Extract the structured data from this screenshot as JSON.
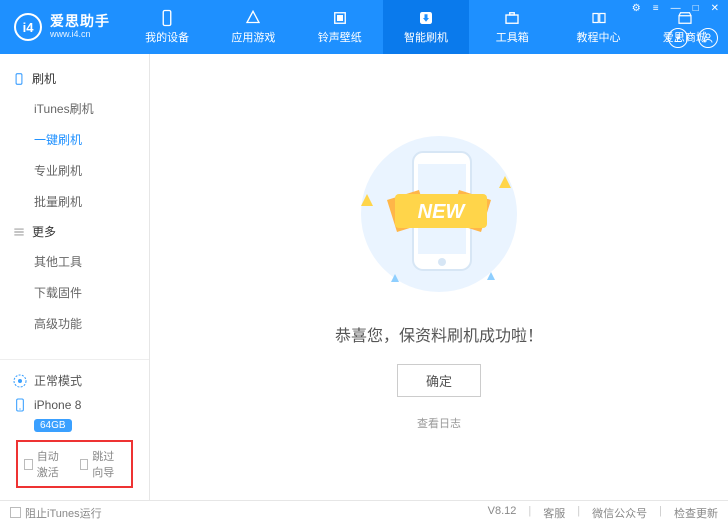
{
  "logo": {
    "badge": "i4",
    "title": "爱思助手",
    "url": "www.i4.cn"
  },
  "nav": [
    {
      "label": "我的设备",
      "icon": "device"
    },
    {
      "label": "应用游戏",
      "icon": "apps"
    },
    {
      "label": "铃声壁纸",
      "icon": "ringtone"
    },
    {
      "label": "智能刷机",
      "icon": "flash",
      "active": true
    },
    {
      "label": "工具箱",
      "icon": "toolbox"
    },
    {
      "label": "教程中心",
      "icon": "tutorial"
    },
    {
      "label": "爱思商城",
      "icon": "store"
    }
  ],
  "sidebar": {
    "groups": [
      {
        "title": "刷机",
        "icon": "phone",
        "items": [
          {
            "label": "iTunes刷机"
          },
          {
            "label": "一键刷机",
            "active": true
          },
          {
            "label": "专业刷机"
          },
          {
            "label": "批量刷机"
          }
        ]
      },
      {
        "title": "更多",
        "icon": "more",
        "items": [
          {
            "label": "其他工具"
          },
          {
            "label": "下载固件"
          },
          {
            "label": "高级功能"
          }
        ]
      }
    ],
    "mode": "正常模式",
    "device": {
      "name": "iPhone 8",
      "storage": "64GB"
    },
    "options": [
      {
        "label": "自动激活",
        "checked": false
      },
      {
        "label": "跳过向导",
        "checked": false
      }
    ]
  },
  "main": {
    "success": "恭喜您，保资料刷机成功啦！",
    "confirm": "确定",
    "log": "查看日志",
    "new_badge": "NEW"
  },
  "footer": {
    "left": "阻止iTunes运行",
    "version": "V8.12",
    "links": [
      "客服",
      "微信公众号",
      "检查更新"
    ]
  }
}
